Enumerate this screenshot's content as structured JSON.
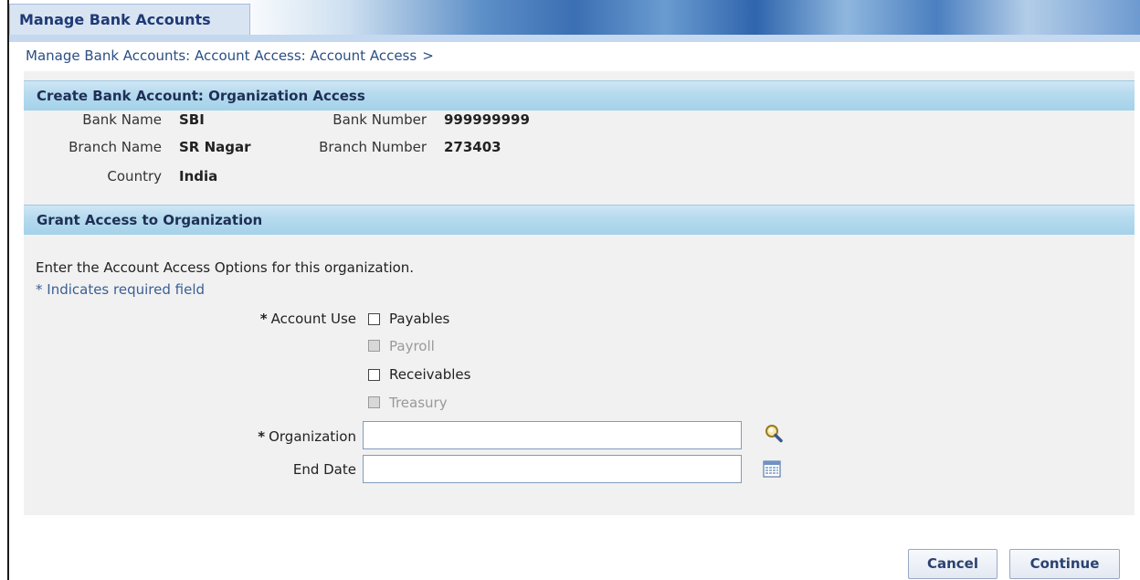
{
  "app": {
    "tab_label": "Manage Bank Accounts"
  },
  "breadcrumb": {
    "text": "Manage Bank Accounts: Account Access: Account Access",
    "separator": ">"
  },
  "section1": {
    "title": "Create Bank Account: Organization Access",
    "fields": {
      "bank_name_label": "Bank Name",
      "bank_name_value": "SBI",
      "bank_number_label": "Bank Number",
      "bank_number_value": "999999999",
      "branch_name_label": "Branch Name",
      "branch_name_value": "SR Nagar",
      "branch_number_label": "Branch Number",
      "branch_number_value": "273403",
      "country_label": "Country",
      "country_value": "India"
    }
  },
  "section2": {
    "title": "Grant Access to Organization",
    "intro": "Enter the Account Access Options for this organization.",
    "required_note": "* Indicates required field",
    "required_mark": "*",
    "account_use_label": "Account Use",
    "options": [
      {
        "label": "Payables",
        "checked": false,
        "disabled": false
      },
      {
        "label": "Payroll",
        "checked": false,
        "disabled": true
      },
      {
        "label": "Receivables",
        "checked": false,
        "disabled": false
      },
      {
        "label": "Treasury",
        "checked": false,
        "disabled": true
      }
    ],
    "organization_label": "Organization",
    "organization_value": "",
    "end_date_label": "End Date",
    "end_date_value": ""
  },
  "buttons": {
    "cancel": "Cancel",
    "continue": "Continue"
  },
  "icons": {
    "search": "search-icon",
    "calendar": "calendar-icon"
  }
}
